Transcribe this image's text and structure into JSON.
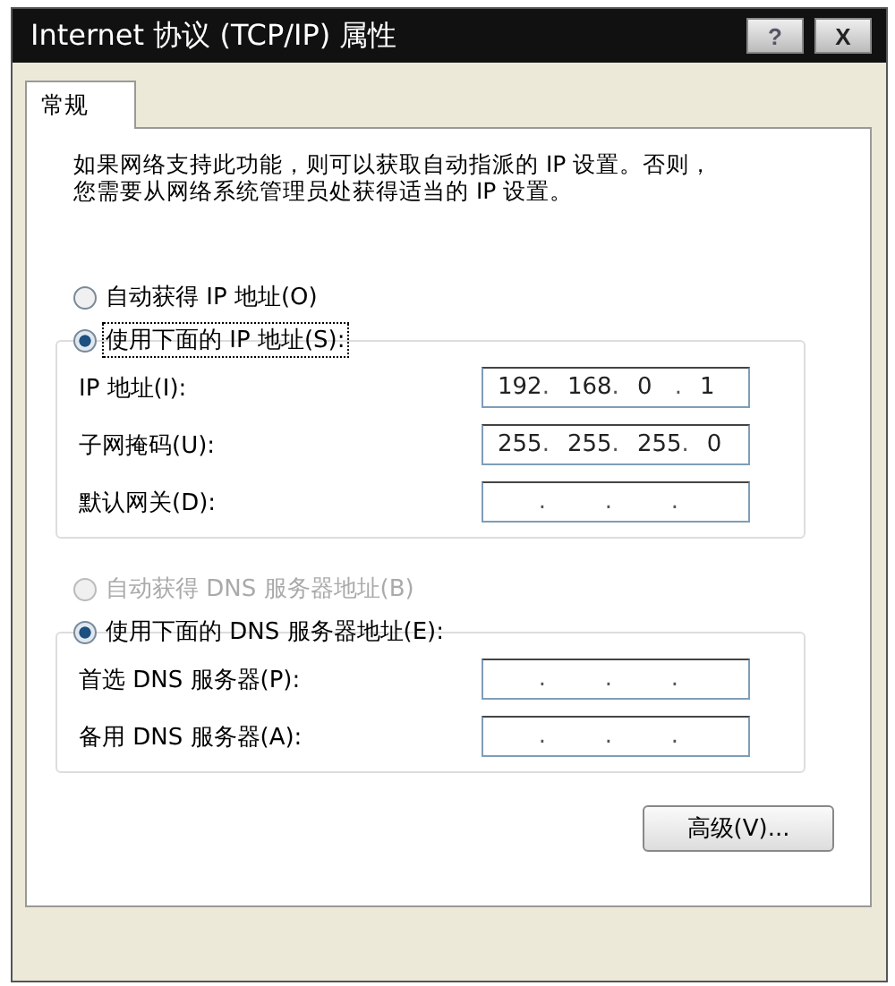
{
  "window": {
    "title": "Internet 协议 (TCP/IP) 属性",
    "buttons": [
      {
        "kind": "help",
        "label": "?"
      },
      {
        "kind": "close",
        "label": "X"
      }
    ]
  },
  "tabs": [
    {
      "label": "常规",
      "selected": true
    }
  ],
  "description": [
    "如果网络支持此功能，则可以获取自动指派的 IP 设置。否则，",
    "您需要从网络系统管理员处获得适当的 IP 设置。"
  ],
  "ip_section": {
    "options": [
      {
        "label": "自动获得 IP 地址(O)",
        "selected": false,
        "disabled": false,
        "focused": false
      },
      {
        "label": "使用下面的 IP 地址(S):",
        "selected": true,
        "disabled": false,
        "focused": true
      }
    ],
    "fields": [
      {
        "label": "IP 地址(I):",
        "octets": [
          "192",
          "168",
          "0",
          "1"
        ]
      },
      {
        "label": "子网掩码(U):",
        "octets": [
          "255",
          "255",
          "255",
          "0"
        ]
      },
      {
        "label": "默认网关(D):"
      }
    ]
  },
  "dns_section": {
    "options": [
      {
        "label": "自动获得 DNS 服务器地址(B)",
        "selected": false,
        "disabled": true,
        "focused": false
      },
      {
        "label": "使用下面的 DNS 服务器地址(E):",
        "selected": true,
        "disabled": false,
        "focused": false
      }
    ],
    "fields": [
      {
        "label": "首选 DNS 服务器(P):"
      },
      {
        "label": "备用 DNS 服务器(A):"
      }
    ]
  },
  "separator": ".",
  "advanced_button": "高级(V)..."
}
